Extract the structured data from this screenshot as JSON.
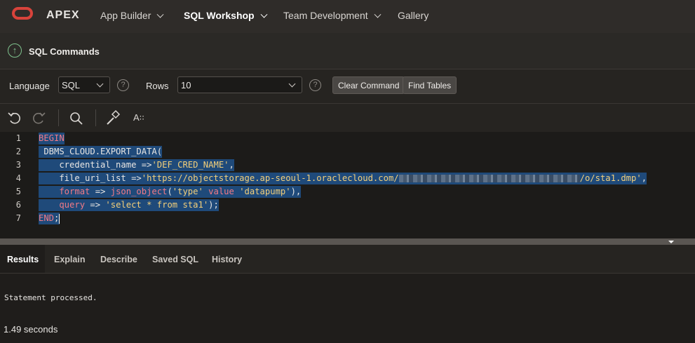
{
  "app": {
    "logo_text": "APEX"
  },
  "nav": {
    "items": [
      {
        "label": "App Builder",
        "has_menu": true
      },
      {
        "label": "SQL Workshop",
        "has_menu": true,
        "active": true
      },
      {
        "label": "Team Development",
        "has_menu": true
      },
      {
        "label": "Gallery",
        "has_menu": false
      }
    ]
  },
  "page": {
    "title": "SQL Commands"
  },
  "toolbar": {
    "language_label": "Language",
    "language_value": "SQL",
    "rows_label": "Rows",
    "rows_value": "10",
    "clear_label": "Clear Command",
    "find_label": "Find Tables"
  },
  "editor": {
    "icons": [
      "undo-icon",
      "redo-icon",
      "search-icon",
      "wrench-icon",
      "autocomplete-icon"
    ],
    "autocomplete_glyph": "A꞉꞉",
    "line_numbers": [
      "1",
      "2",
      "3",
      "4",
      "5",
      "6",
      "7"
    ],
    "lines": {
      "l1_kw": "BEGIN",
      "l2_plain": " DBMS_CLOUD.EXPORT_DATA(",
      "l3_plain": "    credential_name =>",
      "l3_str": "'DEF_CRED_NAME'",
      "l3_tail": ",",
      "l4_plain": "    file_uri_list =>",
      "l4_str_a": "'https://objectstorage.ap-seoul-1.oraclecloud.com/",
      "l4_str_b": "/o/sta1.dmp'",
      "l4_tail": ",",
      "l5_kw": "    format",
      "l5_op": " => ",
      "l5_fn": "json_object",
      "l5_p1": "(",
      "l5_s1": "'type'",
      "l5_kw2": " value ",
      "l5_s2": "'datapump'",
      "l5_tail": "),",
      "l6_kw": "    query",
      "l6_op": " => ",
      "l6_str": "'select * from sta1'",
      "l6_tail": ");",
      "l7_kw": "END",
      "l7_tail": ";"
    }
  },
  "tabs": [
    "Results",
    "Explain",
    "Describe",
    "Saved SQL",
    "History"
  ],
  "results": {
    "message": "Statement processed.",
    "timing": "1.49 seconds"
  },
  "colors": {
    "accent_red": "#d8433b",
    "selection": "#1f4a7a",
    "keyword": "#f27a86",
    "string": "#f3cf7a"
  }
}
